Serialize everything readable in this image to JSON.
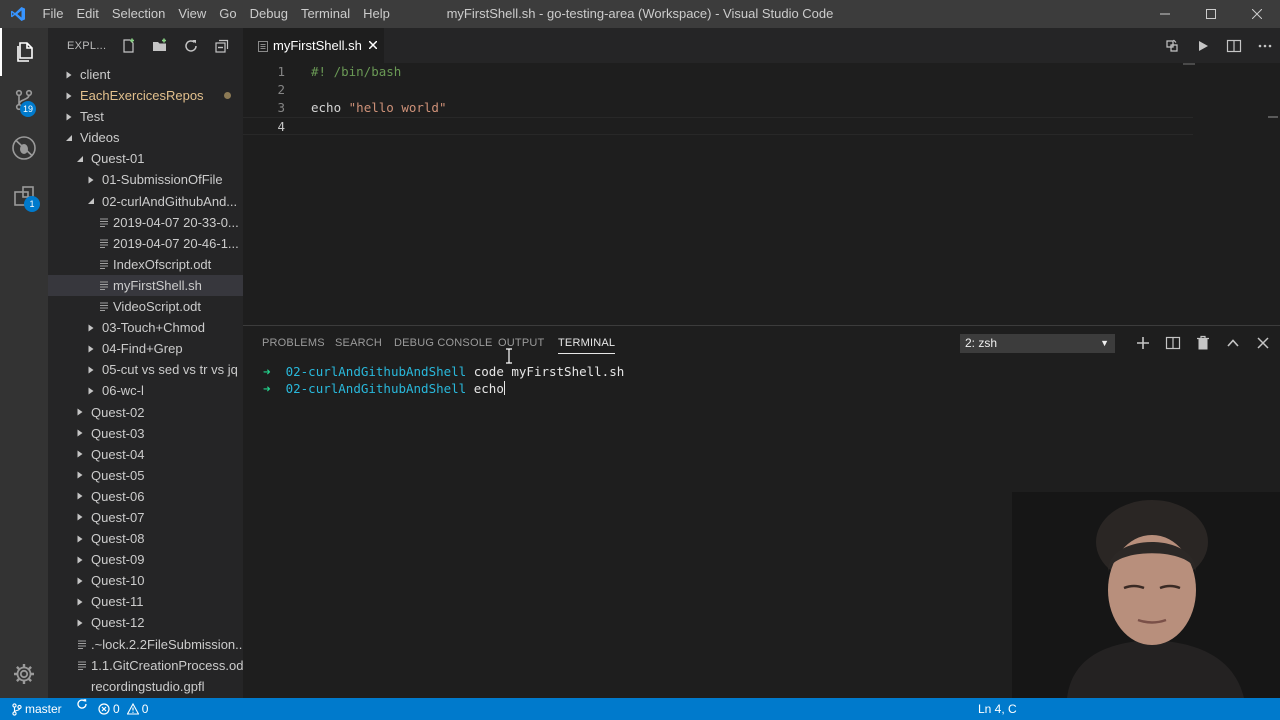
{
  "window": {
    "title": "myFirstShell.sh - go-testing-area (Workspace) - Visual Studio Code",
    "menu": [
      "File",
      "Edit",
      "Selection",
      "View",
      "Go",
      "Debug",
      "Terminal",
      "Help"
    ]
  },
  "activity_bar": {
    "source_control_badge": "19",
    "extensions_badge": "1"
  },
  "sidebar": {
    "title": "EXPL...",
    "tree": [
      {
        "label": "client",
        "type": "folder",
        "expanded": false,
        "depth": 1
      },
      {
        "label": "EachExercicesRepos",
        "type": "folder",
        "expanded": false,
        "depth": 1,
        "modified": true
      },
      {
        "label": "Test",
        "type": "folder",
        "expanded": false,
        "depth": 1
      },
      {
        "label": "Videos",
        "type": "folder",
        "expanded": true,
        "depth": 1
      },
      {
        "label": "Quest-01",
        "type": "folder",
        "expanded": true,
        "depth": 2
      },
      {
        "label": "01-SubmissionOfFile",
        "type": "folder",
        "expanded": false,
        "depth": 3
      },
      {
        "label": "02-curlAndGithubAnd...",
        "type": "folder",
        "expanded": true,
        "depth": 3
      },
      {
        "label": "2019-04-07 20-33-0...",
        "type": "file",
        "depth": 4
      },
      {
        "label": "2019-04-07 20-46-1...",
        "type": "file",
        "depth": 4
      },
      {
        "label": "IndexOfscript.odt",
        "type": "file",
        "depth": 4
      },
      {
        "label": "myFirstShell.sh",
        "type": "file",
        "depth": 4,
        "selected": true
      },
      {
        "label": "VideoScript.odt",
        "type": "file",
        "depth": 4
      },
      {
        "label": "03-Touch+Chmod",
        "type": "folder",
        "expanded": false,
        "depth": 3
      },
      {
        "label": "04-Find+Grep",
        "type": "folder",
        "expanded": false,
        "depth": 3
      },
      {
        "label": "05-cut vs sed vs tr vs jq",
        "type": "folder",
        "expanded": false,
        "depth": 3
      },
      {
        "label": "06-wc-l",
        "type": "folder",
        "expanded": false,
        "depth": 3
      },
      {
        "label": "Quest-02",
        "type": "folder",
        "expanded": false,
        "depth": 2
      },
      {
        "label": "Quest-03",
        "type": "folder",
        "expanded": false,
        "depth": 2
      },
      {
        "label": "Quest-04",
        "type": "folder",
        "expanded": false,
        "depth": 2
      },
      {
        "label": "Quest-05",
        "type": "folder",
        "expanded": false,
        "depth": 2
      },
      {
        "label": "Quest-06",
        "type": "folder",
        "expanded": false,
        "depth": 2
      },
      {
        "label": "Quest-07",
        "type": "folder",
        "expanded": false,
        "depth": 2
      },
      {
        "label": "Quest-08",
        "type": "folder",
        "expanded": false,
        "depth": 2
      },
      {
        "label": "Quest-09",
        "type": "folder",
        "expanded": false,
        "depth": 2
      },
      {
        "label": "Quest-10",
        "type": "folder",
        "expanded": false,
        "depth": 2
      },
      {
        "label": "Quest-11",
        "type": "folder",
        "expanded": false,
        "depth": 2
      },
      {
        "label": "Quest-12",
        "type": "folder",
        "expanded": false,
        "depth": 2
      },
      {
        "label": ".~lock.2.2FileSubmission...",
        "type": "file",
        "depth": 2
      },
      {
        "label": "1.1.GitCreationProcess.odt",
        "type": "file",
        "depth": 2
      },
      {
        "label": "recordingstudio.gpfl",
        "type": "file",
        "depth": 2,
        "no_icon": true
      }
    ]
  },
  "editor": {
    "tab_label": "myFirstShell.sh",
    "lines": [
      {
        "number": "1",
        "text": "#! /bin/bash",
        "kind": "comment"
      },
      {
        "number": "2",
        "text": "",
        "kind": "plain"
      },
      {
        "number": "3",
        "text": "echo ",
        "kind": "plain",
        "string": "\"hello world\""
      },
      {
        "number": "4",
        "text": "",
        "kind": "plain",
        "current": true
      }
    ]
  },
  "panel": {
    "tabs": [
      "PROBLEMS",
      "SEARCH",
      "DEBUG CONSOLE",
      "OUTPUT",
      "TERMINAL"
    ],
    "active_tab": "TERMINAL",
    "terminal_select": "2: zsh",
    "terminal_lines": [
      {
        "arrow": "➜",
        "cwd": "02-curlAndGithubAndShell",
        "command": "code myFirstShell.sh"
      },
      {
        "arrow": "➜",
        "cwd": "02-curlAndGithubAndShell",
        "command": "echo",
        "cursor": true
      }
    ]
  },
  "statusbar": {
    "branch": "master",
    "errors": "0",
    "warnings": "0",
    "position": "Ln 4, C"
  },
  "colors": {
    "accent": "#007acc",
    "terminal_arrow": "#23d18b",
    "terminal_cwd": "#29b8db",
    "comment": "#6a9955",
    "string": "#ce9178"
  }
}
